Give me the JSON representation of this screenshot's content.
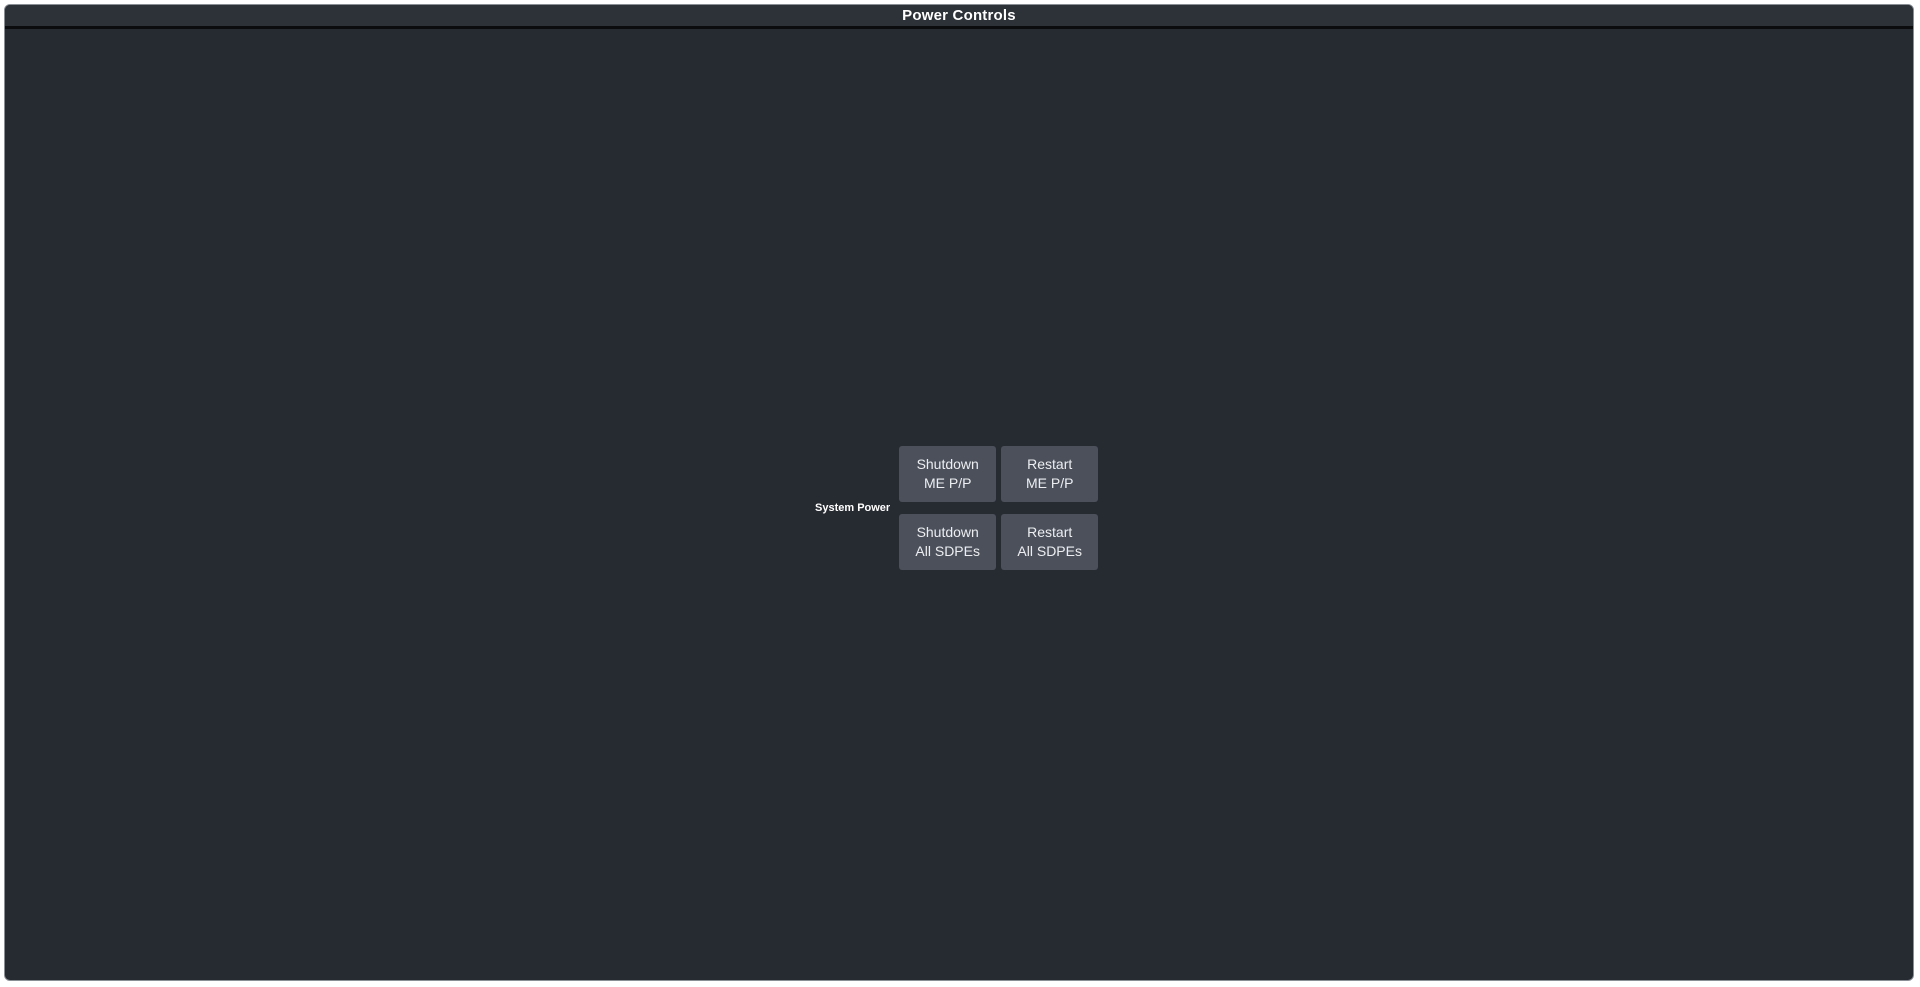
{
  "window": {
    "title": "Power Controls"
  },
  "system_power": {
    "label": "System Power",
    "buttons": [
      {
        "line1": "Shutdown",
        "line2": "ME P/P"
      },
      {
        "line1": "Restart",
        "line2": "ME P/P"
      },
      {
        "line1": "Shutdown",
        "line2": "All SDPEs"
      },
      {
        "line1": "Restart",
        "line2": "All SDPEs"
      }
    ]
  },
  "colors": {
    "background": "#262a31",
    "button": "#4b505b",
    "title_text": "#ffffff",
    "button_text": "#eceef1"
  }
}
